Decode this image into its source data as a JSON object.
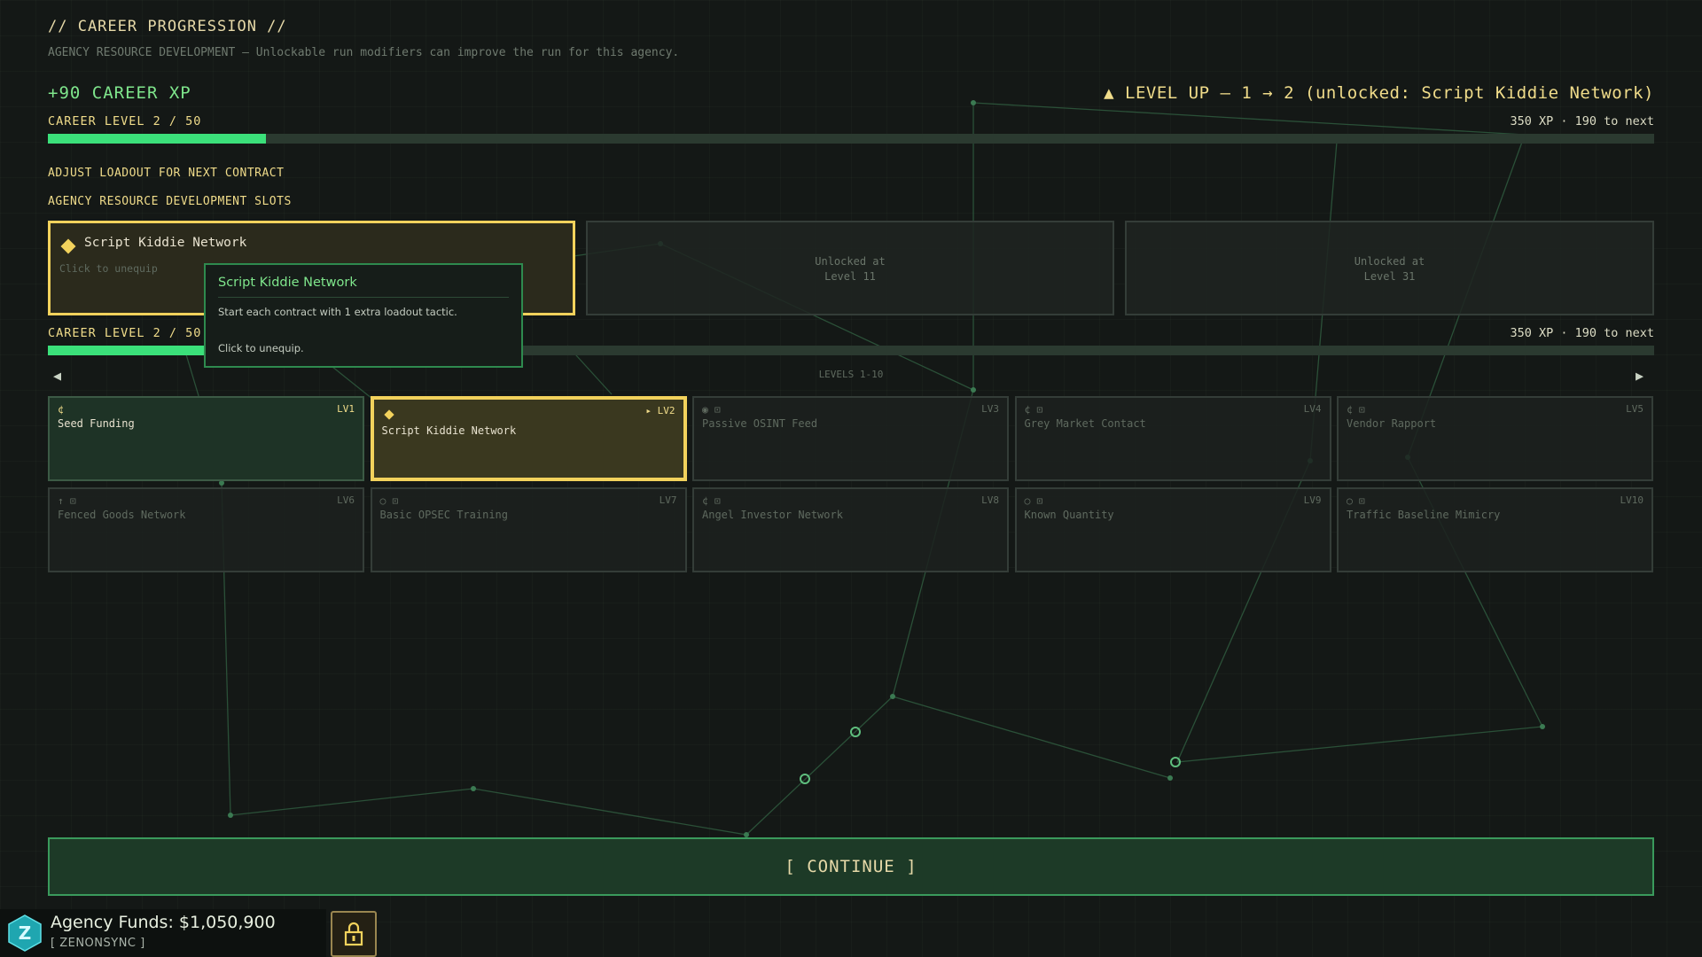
{
  "header": {
    "title": "// CAREER PROGRESSION //",
    "subtitle": "AGENCY RESOURCE DEVELOPMENT — Unlockable run modifiers can improve the run for this agency."
  },
  "xp": {
    "gain": "+90 CAREER XP",
    "level_up": "▲ LEVEL UP — 1 → 2  (unlocked: Script Kiddie Network)",
    "level_label": "CAREER LEVEL 2 / 50",
    "info": "350 XP  ·  190 to next",
    "progress": 0.136
  },
  "loadout": {
    "heading": "ADJUST LOADOUT FOR NEXT CONTRACT",
    "slots_heading": "AGENCY RESOURCE DEVELOPMENT SLOTS",
    "slots": [
      {
        "name": "Script Kiddie Network",
        "hint": "Click to unequip",
        "active": true
      },
      {
        "locked_text": "Unlocked at\nLevel 11"
      },
      {
        "locked_text": "Unlocked at\nLevel 31"
      }
    ]
  },
  "tooltip": {
    "title": "Script Kiddie Network",
    "desc": "Start each contract with 1 extra loadout tactic.",
    "click": "Click to unequip."
  },
  "pager": {
    "label": "LEVELS 1-10",
    "prev": "◀",
    "next": "▶"
  },
  "unlocks": [
    {
      "name": "Seed Funding",
      "level": "LV1",
      "icons": "¢",
      "state": "owned"
    },
    {
      "name": "Script Kiddie Network",
      "level": "▸ LV2",
      "icons": "",
      "state": "equipped"
    },
    {
      "name": "Passive OSINT Feed",
      "level": "LV3",
      "icons": "◉ ⊡",
      "state": "locked"
    },
    {
      "name": "Grey Market Contact",
      "level": "LV4",
      "icons": "¢ ⊡",
      "state": "locked"
    },
    {
      "name": "Vendor Rapport",
      "level": "LV5",
      "icons": "¢ ⊡",
      "state": "locked"
    },
    {
      "name": "Fenced Goods Network",
      "level": "LV6",
      "icons": "↑ ⊡",
      "state": "locked"
    },
    {
      "name": "Basic OPSEC Training",
      "level": "LV7",
      "icons": "○ ⊡",
      "state": "locked"
    },
    {
      "name": "Angel Investor Network",
      "level": "LV8",
      "icons": "¢ ⊡",
      "state": "locked"
    },
    {
      "name": "Known Quantity",
      "level": "LV9",
      "icons": "○ ⊡",
      "state": "locked"
    },
    {
      "name": "Traffic Baseline Mimicry",
      "level": "LV10",
      "icons": "○ ⊡",
      "state": "locked"
    }
  ],
  "continue_label": "[ CONTINUE ]",
  "footer": {
    "funds": "Agency Funds: $1,050,900",
    "agency": "[ ZENONSYNC ]",
    "logo_letter": "Z"
  },
  "colors": {
    "accent_green": "#3be07a",
    "accent_gold": "#f2d25c",
    "background": "#141816"
  }
}
